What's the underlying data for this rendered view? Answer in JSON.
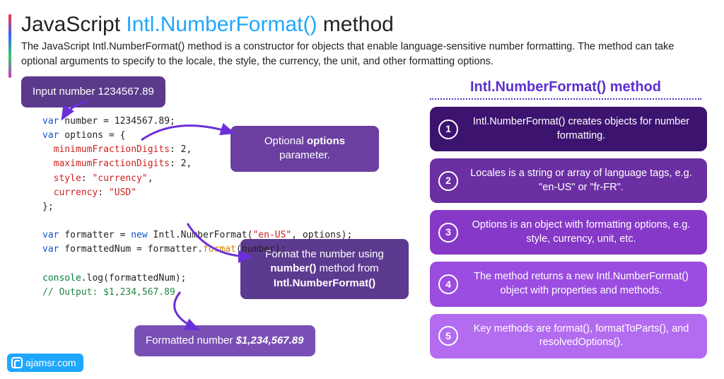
{
  "title_pre": "JavaScript ",
  "title_accent": "Intl.NumberFormat()",
  "title_post": " method",
  "desc": "The JavaScript Intl.NumberFormat() method is a constructor for objects that enable language-sensitive number formatting. The method can take optional arguments to specify to the locale, the style, the currency, the unit, and other formatting options.",
  "pill_input": "Input number 1234567.89",
  "pill_options_pre": "Optional ",
  "pill_options_strong": "options",
  "pill_options_post": " parameter.",
  "pill_format_l1": "Format the number using",
  "pill_format_l2a": "number()",
  "pill_format_l2b": " method from",
  "pill_format_l3": "Intl.NumberFormat()",
  "pill_output_pre": "Formatted number ",
  "pill_output_val": "$1,234,567.89",
  "code": {
    "l1a": "var",
    "l1b": " number = 1234567.89;",
    "l2a": "var",
    "l2b": " options = {",
    "l3k": "  minimumFractionDigits",
    "l3v": ": 2,",
    "l4k": "  maximumFractionDigits",
    "l4v": ": 2,",
    "l5k": "  style",
    "l5v": ": ",
    "l5s": "\"currency\"",
    "l5e": ",",
    "l6k": "  currency",
    "l6v": ": ",
    "l6s": "\"USD\"",
    "l7": "};",
    "l9a": "var",
    "l9b": " formatter = ",
    "l9c": "new",
    "l9d": " Intl.NumberFormat(",
    "l9e": "\"en-US\"",
    "l9f": ", options);",
    "l10a": "var",
    "l10b": " formattedNum = formatter.",
    "l10c": "format",
    "l10d": "(number);",
    "l12a": "console",
    "l12b": ".log(formattedNum);",
    "l13": "// Output: $1,234,567.89"
  },
  "panel_title": "Intl.NumberFormat() method",
  "steps": [
    {
      "n": "1",
      "t": "Intl.NumberFormat() creates objects for number formatting."
    },
    {
      "n": "2",
      "t": "Locales is a string or array of language tags, e.g. \"en-US\" or \"fr-FR\"."
    },
    {
      "n": "3",
      "t": "Options is an object with formatting options, e.g. style, currency, unit, etc."
    },
    {
      "n": "4",
      "t": "The method returns a new Intl.NumberFormat() object with properties and methods."
    },
    {
      "n": "5",
      "t": "Key methods are format(), formatToParts(), and resolvedOptions()."
    }
  ],
  "watermark": "ajamsr.com"
}
